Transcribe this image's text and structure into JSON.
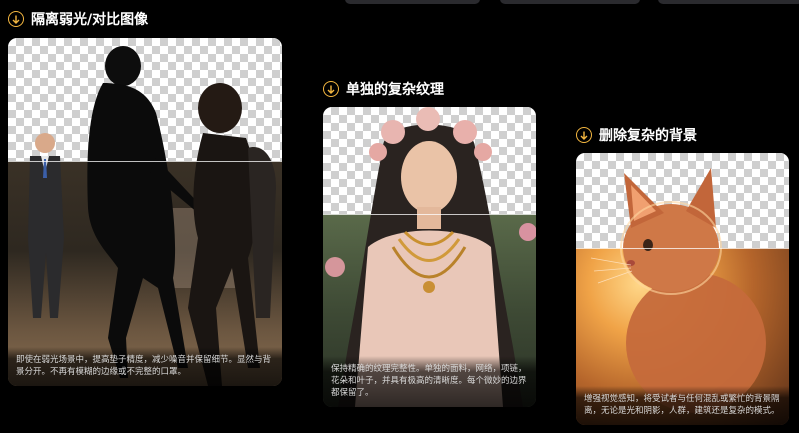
{
  "sections": [
    {
      "title": "隔离弱光/对比图像",
      "caption": "即使在弱光场景中，提高垫子精度，减少噪音并保留细节。显然与背景分开。不再有模糊的边缘或不完整的口罩。"
    },
    {
      "title": "单独的复杂纹理",
      "caption": "保持精确的纹理完整性。单独的面料，网络，项链，花朵和叶子，并具有极高的清晰度。每个微妙的边界都保留了。"
    },
    {
      "title": "删除复杂的背景",
      "caption": "增强视觉感知，将受试者与任何混乱或繁忙的背景隔离，无论是光和阴影，人群，建筑还是复杂的模式。"
    }
  ],
  "icons": {
    "section_icon": "arrow-down-circle-icon"
  },
  "colors": {
    "accent": "#f4b740",
    "background": "#000000"
  }
}
